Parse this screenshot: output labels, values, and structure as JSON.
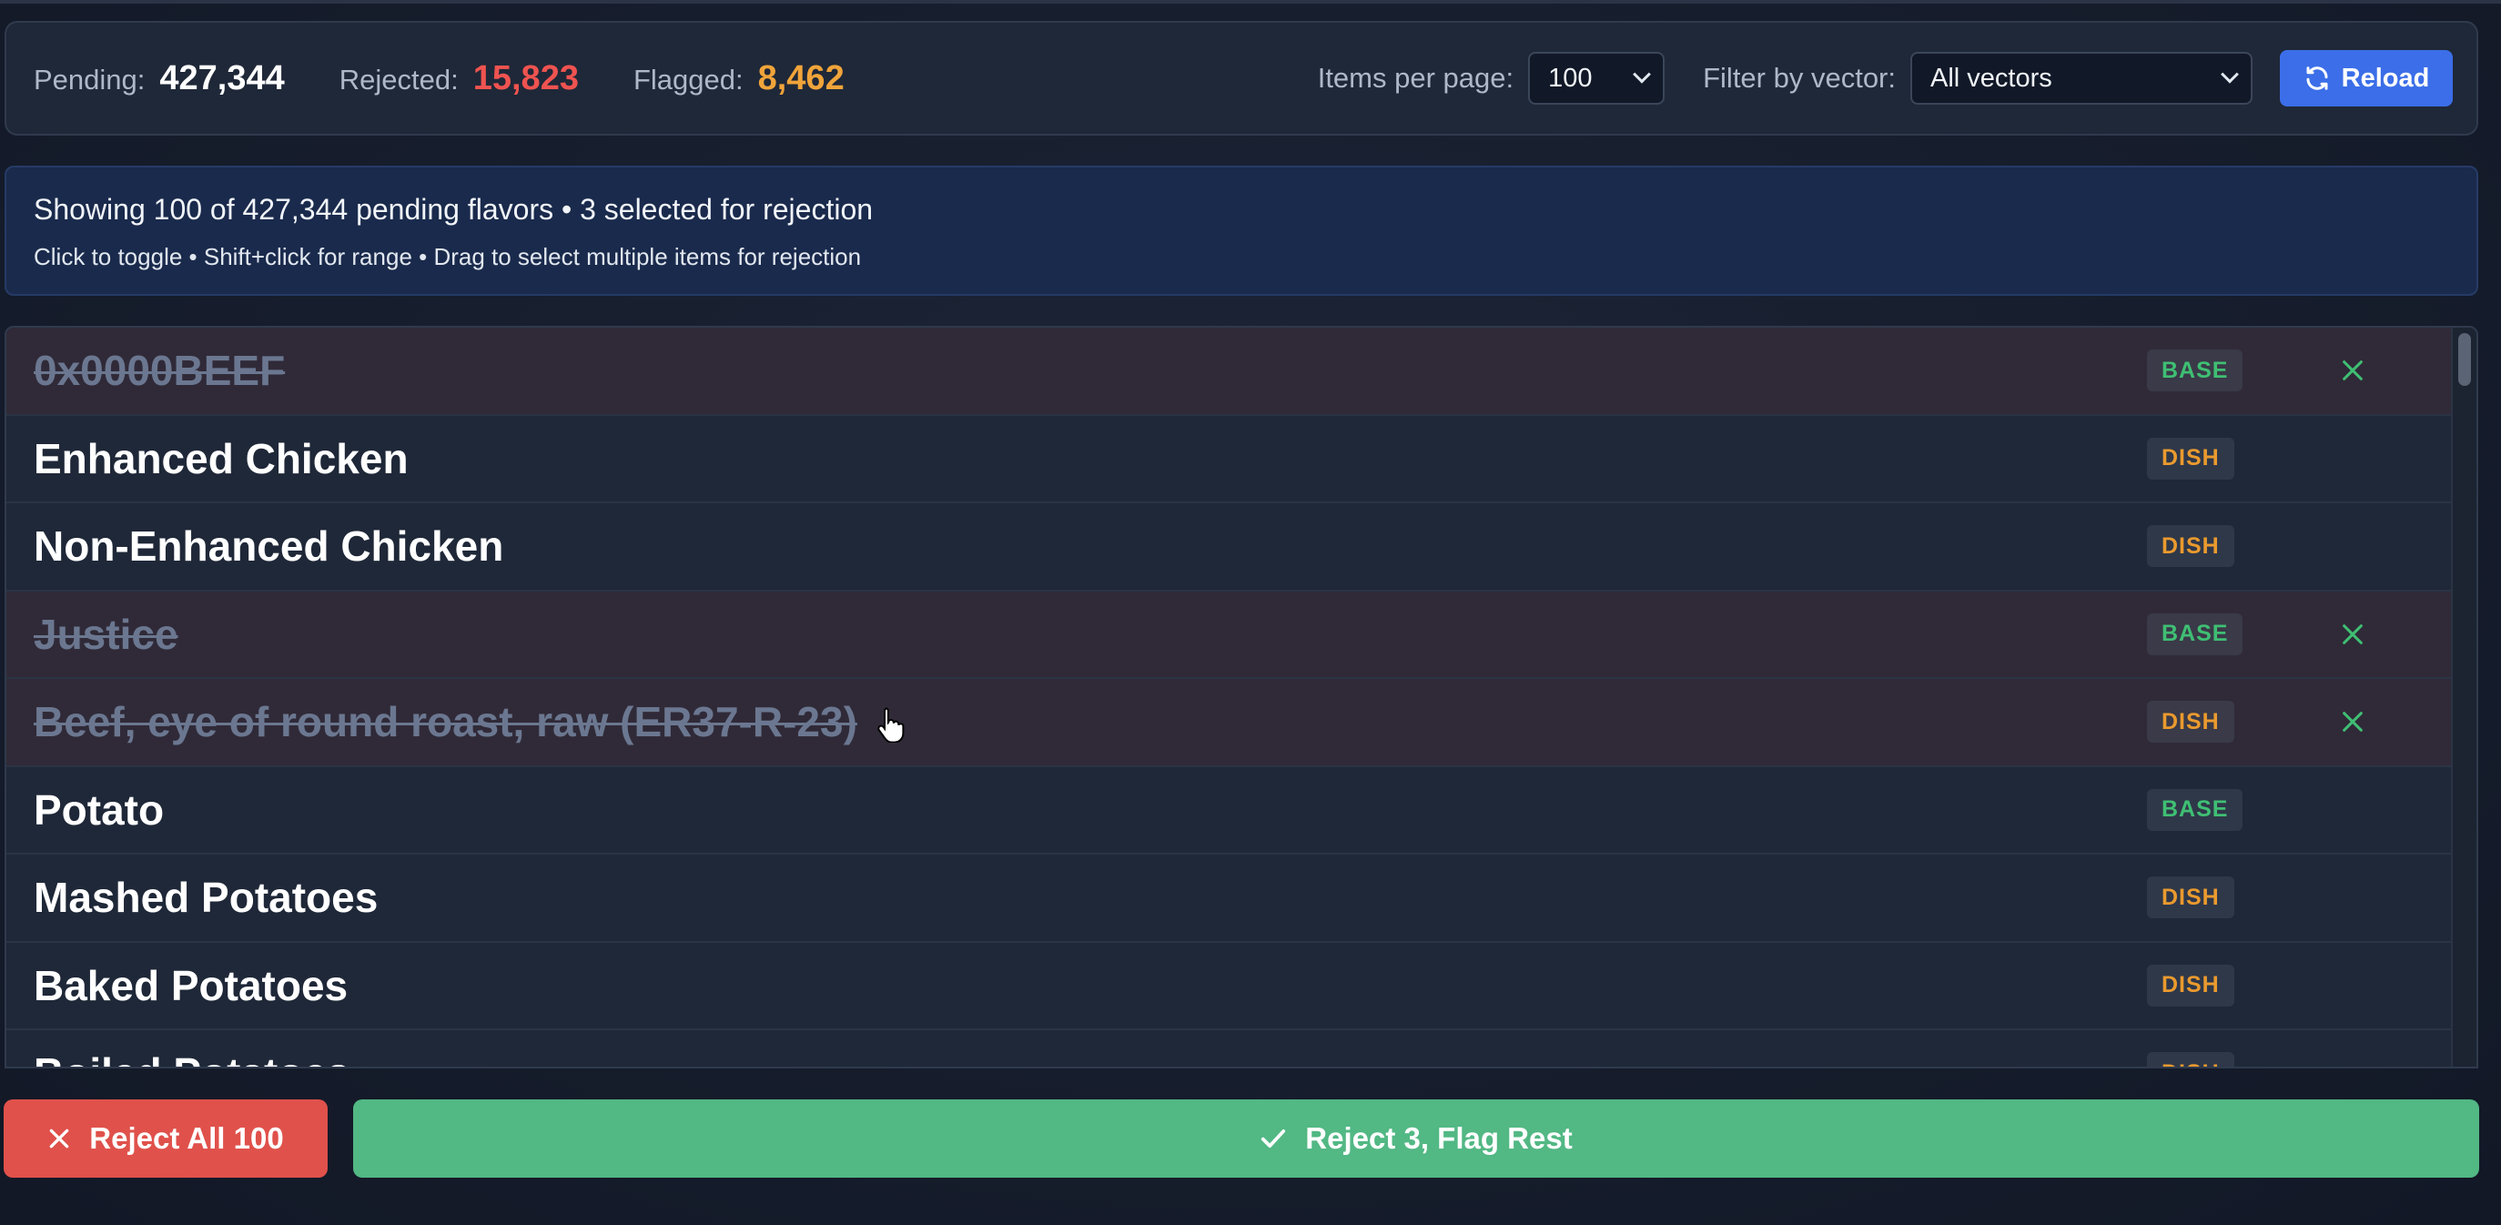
{
  "stats": {
    "pending_label": "Pending:",
    "pending_value": "427,344",
    "rejected_label": "Rejected:",
    "rejected_value": "15,823",
    "flagged_label": "Flagged:",
    "flagged_value": "8,462"
  },
  "controls": {
    "items_per_page_label": "Items per page:",
    "items_per_page_value": "100",
    "filter_label": "Filter by vector:",
    "filter_value": "All vectors",
    "reload_label": "Reload"
  },
  "info": {
    "summary": "Showing 100 of 427,344 pending flavors • 3 selected for rejection",
    "hint": "Click to toggle • Shift+click for range • Drag to select multiple items for rejection"
  },
  "rows": [
    {
      "name": "0x0000BEEF",
      "tag": "BASE",
      "rejected": true
    },
    {
      "name": "Enhanced Chicken",
      "tag": "DISH",
      "rejected": false
    },
    {
      "name": "Non-Enhanced Chicken",
      "tag": "DISH",
      "rejected": false
    },
    {
      "name": "Justice",
      "tag": "BASE",
      "rejected": true
    },
    {
      "name": "Beef, eye of round roast, raw (ER37-R-23)",
      "tag": "DISH",
      "rejected": true
    },
    {
      "name": "Potato",
      "tag": "BASE",
      "rejected": false
    },
    {
      "name": "Mashed Potatoes",
      "tag": "DISH",
      "rejected": false
    },
    {
      "name": "Baked Potatoes",
      "tag": "DISH",
      "rejected": false
    },
    {
      "name": "Boiled Potatoes",
      "tag": "DISH",
      "rejected": false
    }
  ],
  "actions": {
    "reject_all_label": "Reject All 100",
    "reject_flag_label": "Reject 3, Flag Rest"
  },
  "colors": {
    "pending": "#ffffff",
    "rejected": "#ef5350",
    "flagged": "#f0a43a",
    "reload": "#3b6ee8",
    "reject_all": "#e0514b",
    "reject_flag": "#52b884",
    "base_tag": "#3fbf73",
    "dish_tag": "#ea9a2e"
  },
  "icons": {
    "reload": "refresh-icon",
    "reject_row": "x-icon",
    "reject_all": "x-icon",
    "reject_flag": "check-icon"
  }
}
